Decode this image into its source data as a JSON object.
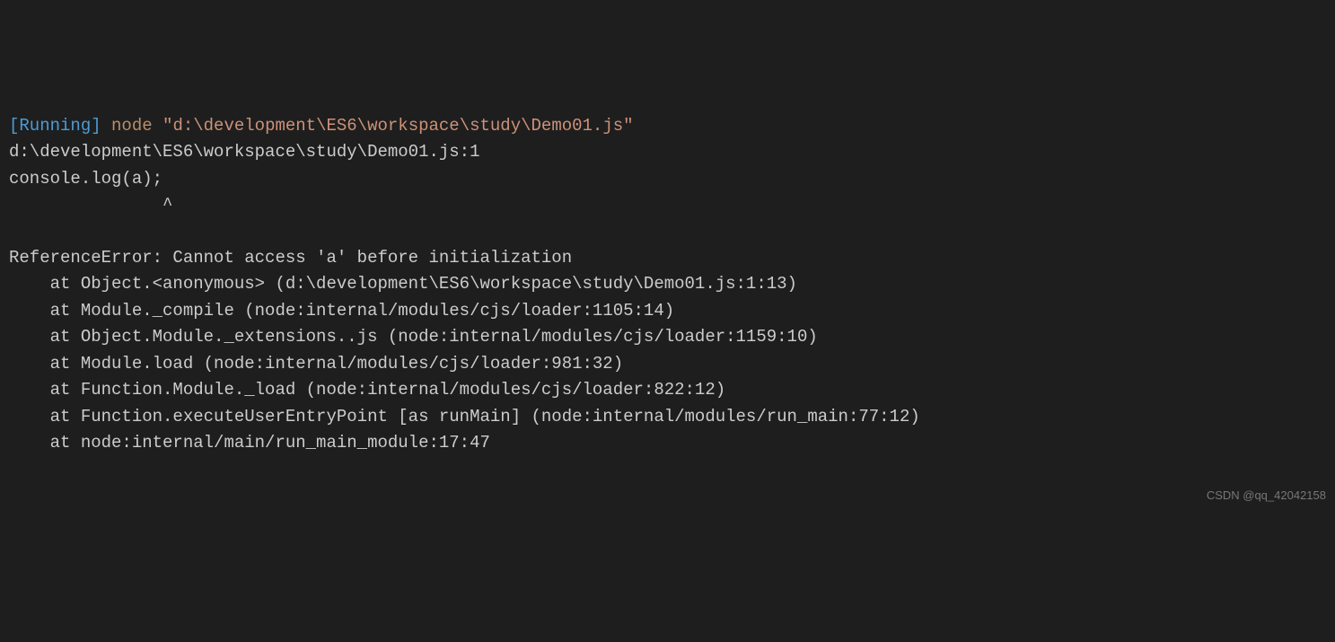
{
  "line1": {
    "running": "[Running]",
    "node": "node",
    "path": "\"d:\\development\\ES6\\workspace\\study\\Demo01.js\""
  },
  "line2": "d:\\development\\ES6\\workspace\\study\\Demo01.js:1",
  "line3": "console.log(a);",
  "line4": "               ^",
  "line5": "",
  "error": "ReferenceError: Cannot access 'a' before initialization",
  "stack": [
    "    at Object.<anonymous> (d:\\development\\ES6\\workspace\\study\\Demo01.js:1:13)",
    "    at Module._compile (node:internal/modules/cjs/loader:1105:14)",
    "    at Object.Module._extensions..js (node:internal/modules/cjs/loader:1159:10)",
    "    at Module.load (node:internal/modules/cjs/loader:981:32)",
    "    at Function.Module._load (node:internal/modules/cjs/loader:822:12)",
    "    at Function.executeUserEntryPoint [as runMain] (node:internal/modules/run_main:77:12)",
    "    at node:internal/main/run_main_module:17:47"
  ],
  "watermark": "CSDN @qq_42042158"
}
